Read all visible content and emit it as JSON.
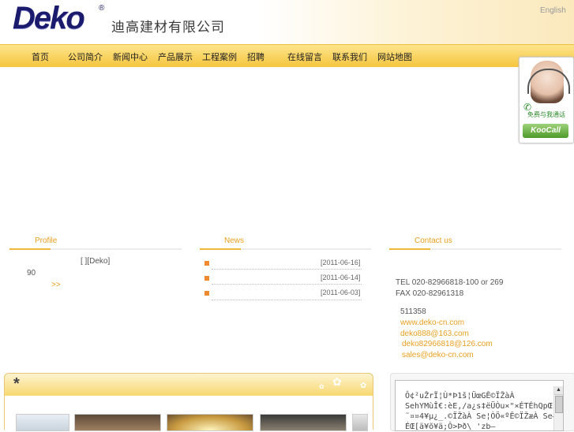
{
  "header": {
    "logo": "Deko",
    "logo_mark": "®",
    "company_name": "迪高建材有限公司",
    "language_link": "English"
  },
  "nav": {
    "items": [
      "首页",
      "公司简介",
      "新闻中心",
      "产品展示",
      "工程案例",
      "招聘",
      "在线留言",
      "联系我们",
      "网站地图"
    ]
  },
  "call_widget": {
    "callme_text": "免费与我通话",
    "brand": "KooCall"
  },
  "profile": {
    "title": "Profile",
    "line1": "[ ][Deko]",
    "line2": "90",
    "more": ">>"
  },
  "news": {
    "title": "News",
    "items": [
      {
        "date": "[2011-06-16]"
      },
      {
        "date": "[2011-06-14]"
      },
      {
        "date": "[2011-06-03]"
      }
    ]
  },
  "contact": {
    "title": "Contact us",
    "tel": "TEL 020-82966818-100 or 269",
    "fax": "FAX 020-82961318",
    "postcode": "511358",
    "website": "www.deko-cn.com",
    "emails": [
      "deko888@163.com",
      "deko82966818@126.com",
      "sales@deko-cn.com"
    ]
  },
  "banner": {
    "star": "*"
  },
  "textbox": {
    "lines": [
      "Ô¢²uŽrÏ¦Ù*Þ1š¦ÜœGÊ©ÏŽàÀ",
      "SehYMùÎ€:èE,/a¿s‡ëÜÒu×\"×ÉTÉhQpŒ",
      "˜¤¤4¥µ¿_.©ÏŽàÀ Se¦ÒÖ«ºÊ©ÏŽæÀ Se–",
      "ÉŒ[ä¥õ¥ä;Ô>Þð\\ 'zb–"
    ],
    "scroll_up": "▲"
  },
  "colors": {
    "accent": "#e8a020",
    "nav_bg": "#f5c53f",
    "logo": "#1b1b6e",
    "bullet": "#f08a30"
  }
}
